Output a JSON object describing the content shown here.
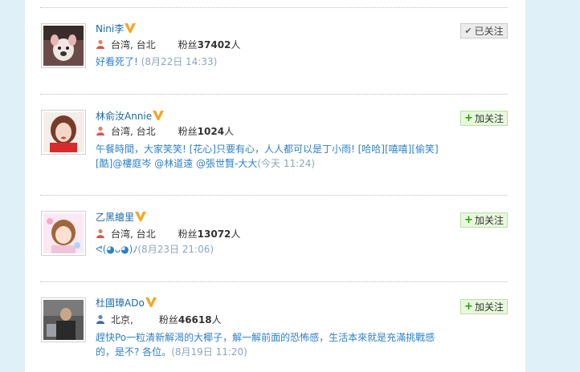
{
  "users": [
    {
      "name": "Nini李",
      "location": "台湾, 台北",
      "fans_label": "粉丝",
      "fans_count": "37402",
      "fans_unit": "人",
      "status_text": "好看死了!",
      "status_time": "(8月22日 14:33)",
      "follow_label": "已关注",
      "followed": true
    },
    {
      "name": "林俞汝Annie",
      "location": "台湾, 台北",
      "fans_label": "粉丝",
      "fans_count": "1024",
      "fans_unit": "人",
      "status_text": "午餐時間，大家笑笑! [花心]只要有心，人人都可以是丁小雨! [哈哈][嘻嘻][偷笑][酷]@樓庭岑 @林道遠 @張世賢-大大",
      "status_time": "(今天 11:24)",
      "follow_label": "加关注",
      "followed": false
    },
    {
      "name": "乙黑繪里",
      "location": "台湾, 台北",
      "fans_label": "粉丝",
      "fans_count": "13072",
      "fans_unit": "人",
      "status_text": "ᕙ(◕ᴗ◕)ﾉ",
      "status_time": "(8月23日 21:06)",
      "follow_label": "加关注",
      "followed": false
    },
    {
      "name": "杜國璋ADo",
      "location": "北京,",
      "fans_label": "粉丝",
      "fans_count": "46618",
      "fans_unit": "人",
      "status_text": "趕快Po一粒清新解渴的大椰子，解一解前面的恐怖感，生活本來就是充滿挑戰感的，是不? 各位。",
      "status_time": "(8月19日 11:20)",
      "follow_label": "加关注",
      "followed": false
    }
  ],
  "colors": {
    "name": "#1a6aa7",
    "status": "#2e80c6",
    "time": "#8aa6bd",
    "follow_bg": "#e7f8dc",
    "page_bg": "#dff0f8"
  }
}
